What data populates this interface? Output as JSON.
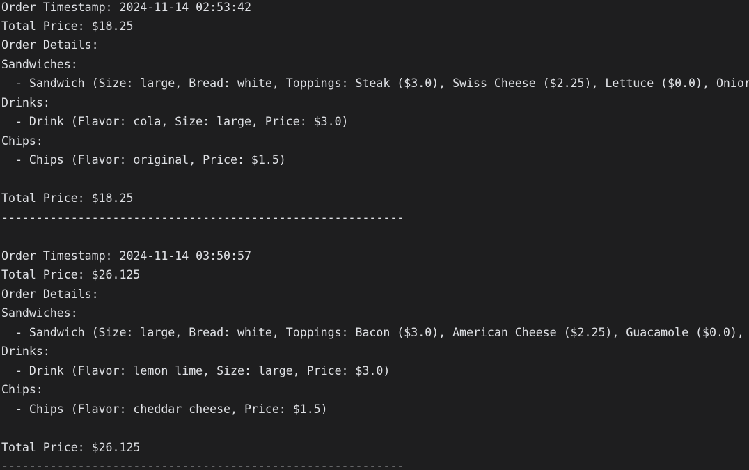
{
  "console": {
    "lines": [
      "Order Timestamp: 2024-11-14 02:53:42",
      "Total Price: $18.25",
      "Order Details:",
      "Sandwiches:",
      "  - Sandwich (Size: large, Bread: white, Toppings: Steak ($3.0), Swiss Cheese ($2.25), Lettuce ($0.0), Onior",
      "Drinks:",
      "  - Drink (Flavor: cola, Size: large, Price: $3.0)",
      "Chips:",
      "  - Chips (Flavor: original, Price: $1.5)",
      "",
      "Total Price: $18.25",
      "----------------------------------------------------------",
      "",
      "Order Timestamp: 2024-11-14 03:50:57",
      "Total Price: $26.125",
      "Order Details:",
      "Sandwiches:",
      "  - Sandwich (Size: large, Bread: white, Toppings: Bacon ($3.0), American Cheese ($2.25), Guacamole ($0.0),",
      "Drinks:",
      "  - Drink (Flavor: lemon lime, Size: large, Price: $3.0)",
      "Chips:",
      "  - Chips (Flavor: cheddar cheese, Price: $1.5)",
      "",
      "Total Price: $26.125",
      "----------------------------------------------------------"
    ]
  },
  "colors": {
    "background": "#1e1e1f",
    "text": "#dfe1e5"
  }
}
